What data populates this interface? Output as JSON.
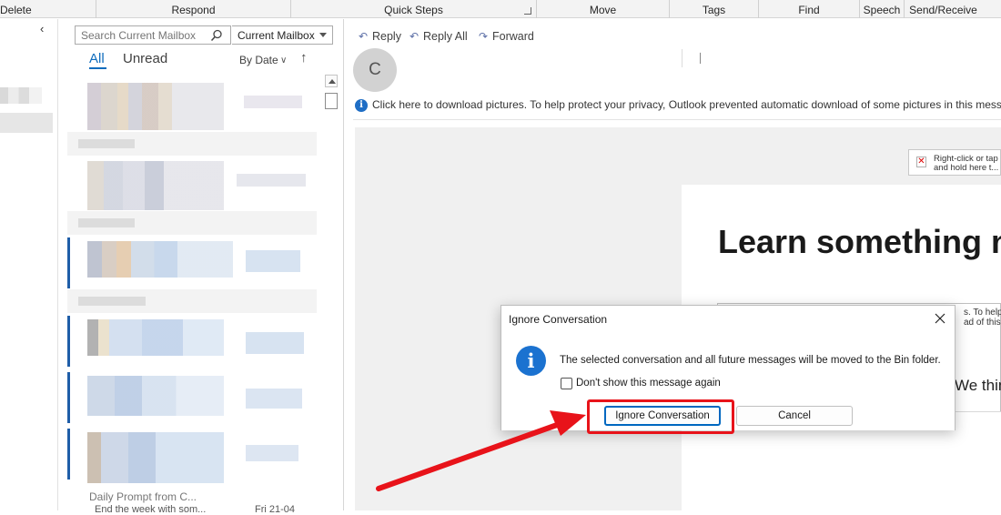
{
  "ribbon": {
    "groups": [
      "Delete",
      "Respond",
      "Quick Steps",
      "Move",
      "Tags",
      "Find",
      "Speech",
      "Send/Receive"
    ]
  },
  "search": {
    "placeholder": "Search Current Mailbox",
    "scope": "Current Mailbox"
  },
  "list": {
    "tab_all": "All",
    "tab_unread": "Unread",
    "sort_by": "By Date",
    "last_item_subject": "Daily Prompt from C...",
    "last_item_preview": "End the week with som...",
    "last_item_date": "Fri 21-04"
  },
  "reading": {
    "actions": [
      "Reply",
      "Reply All",
      "Forward"
    ],
    "sender_initial": "C",
    "info_bar": "Click here to download pictures. To help protect your privacy, Outlook prevented automatic download of some pictures in this message.",
    "broken_image_text_1": "Right-click or tap",
    "broken_image_text_2": "and hold here t...",
    "headline": "Learn something n",
    "box_text_1": "s. To help p",
    "box_text_2": "ad of this",
    "we_think": "We think"
  },
  "dialog": {
    "title": "Ignore Conversation",
    "message": "The selected conversation and all future messages will be moved to the Bin folder.",
    "checkbox_label": "Don't show this message again",
    "checkbox_checked": false,
    "primary_button": "Ignore Conversation",
    "cancel_button": "Cancel"
  },
  "colors": {
    "accent": "#0f6cbd",
    "annotation": "#e8131a"
  }
}
